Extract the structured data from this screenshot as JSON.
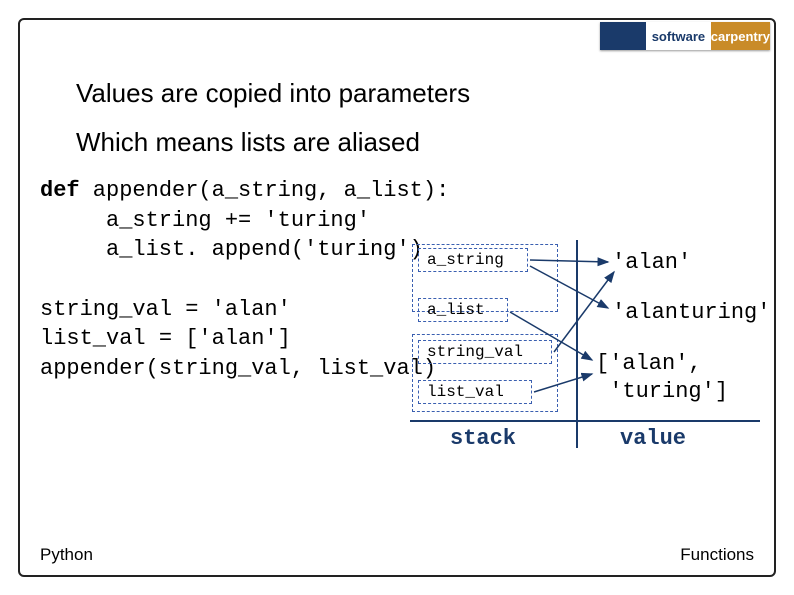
{
  "logo": {
    "left_top": "",
    "left_bot": "",
    "mid": "software",
    "right": "carpentry"
  },
  "bullets": {
    "line1": "Values are copied into parameters",
    "line2": "Which means lists are aliased"
  },
  "code": {
    "kw_def": "def",
    "sig": " appender(a_string, a_list):",
    "l2": "a_string += 'turing'",
    "l3": "a_list. append('turing')",
    "l5": "string_val = 'alan'",
    "l6": "list_val = ['alan']",
    "l7": "appender(string_val, list_val)"
  },
  "diagram": {
    "a_string": "a_string",
    "a_list": "a_list",
    "string_val": "string_val",
    "list_val": "list_val",
    "alan": "'alan'",
    "alanturing": "'alanturing'",
    "listval": "['alan',\n 'turing']",
    "stack": "stack",
    "value": "value"
  },
  "footer": {
    "left": "Python",
    "right": "Functions"
  }
}
